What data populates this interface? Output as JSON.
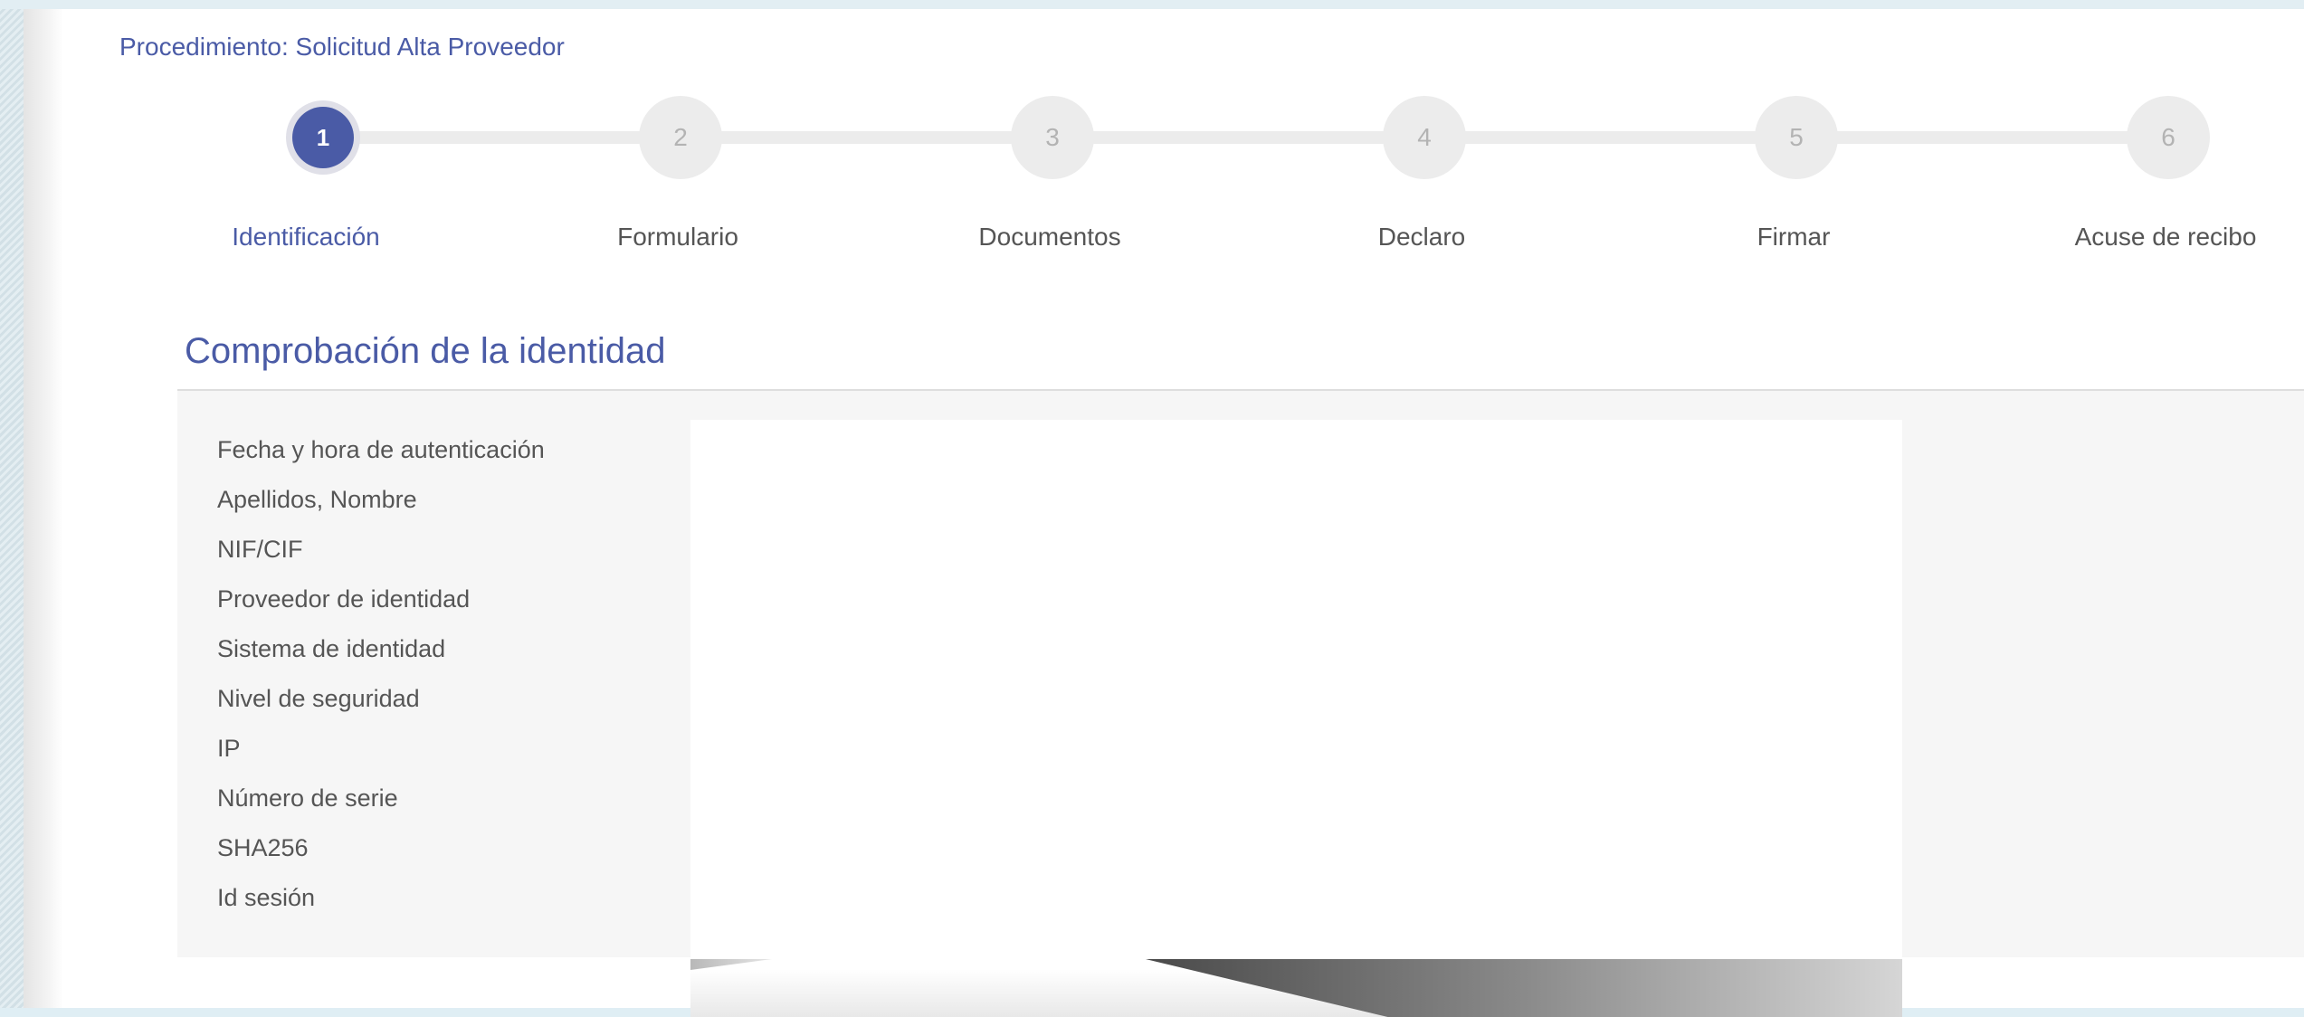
{
  "procedure": {
    "title": "Procedimiento: Solicitud Alta Proveedor"
  },
  "stepper": {
    "active_step": 1,
    "steps": [
      {
        "number": "1",
        "label": "Identificación"
      },
      {
        "number": "2",
        "label": "Formulario"
      },
      {
        "number": "3",
        "label": "Documentos"
      },
      {
        "number": "4",
        "label": "Declaro"
      },
      {
        "number": "5",
        "label": "Firmar"
      },
      {
        "number": "6",
        "label": "Acuse de recibo"
      }
    ]
  },
  "identity_section": {
    "title": "Comprobación de la identidad",
    "fields": [
      {
        "label": "Fecha y hora de autenticación"
      },
      {
        "label": "Apellidos, Nombre"
      },
      {
        "label": "NIF/CIF"
      },
      {
        "label": "Proveedor de identidad"
      },
      {
        "label": "Sistema de identidad"
      },
      {
        "label": "Nivel de seguridad"
      },
      {
        "label": "IP"
      },
      {
        "label": "Número de serie"
      },
      {
        "label": "SHA256"
      },
      {
        "label": "Id sesión"
      }
    ]
  },
  "colors": {
    "accent": "#4a5ba6",
    "inactive_step": "#ececec",
    "label_text": "#555555",
    "panel_background": "#f6f6f6"
  }
}
